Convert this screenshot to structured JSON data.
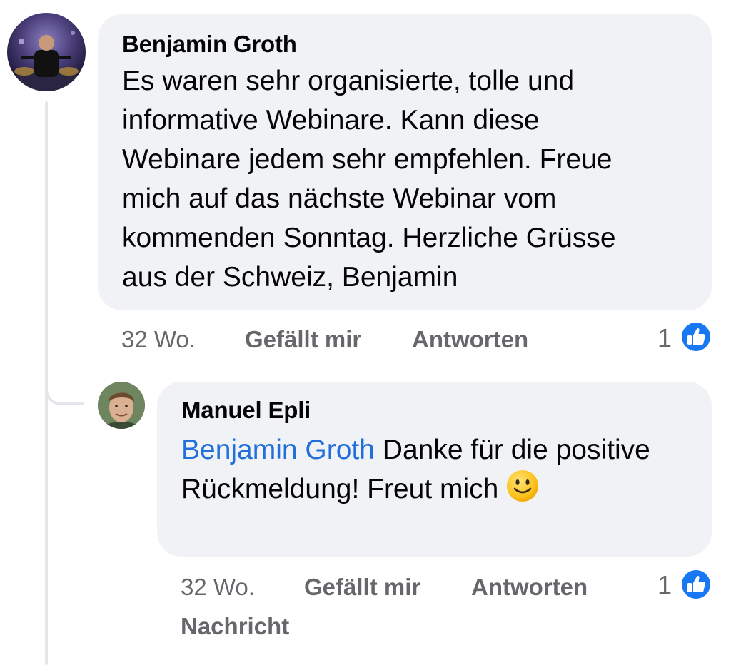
{
  "comments": [
    {
      "author": "Benjamin Groth",
      "text": "Es waren sehr organisierte, tolle und\ninformative Webinare. Kann diese\nWebinare jedem sehr empfehlen. Freue\nmich auf das nächste Webinar vom\nkommenden Sonntag. Herzliche Grüsse\naus der Schweiz, Benjamin",
      "time": "32 Wo.",
      "like_label": "Gefällt mir",
      "reply_label": "Antworten",
      "reaction_count": "1"
    }
  ],
  "replies": [
    {
      "author": "Manuel Epli",
      "mention": "Benjamin Groth",
      "text": " Danke für die positive Rückmeldung! Freut mich ",
      "time": "32 Wo.",
      "like_label": "Gefällt mir",
      "reply_label": "Antworten",
      "message_label": "Nachricht",
      "reaction_count": "1"
    }
  ],
  "colors": {
    "bubble": "#f0f2f5",
    "mention": "#216fdb",
    "meta": "#65676b",
    "like_blue": "#1877f2",
    "thread_line": "#e4e6eb"
  },
  "icons": {
    "like": "like-icon",
    "emoji": "slightly-smiling-face-emoji"
  }
}
